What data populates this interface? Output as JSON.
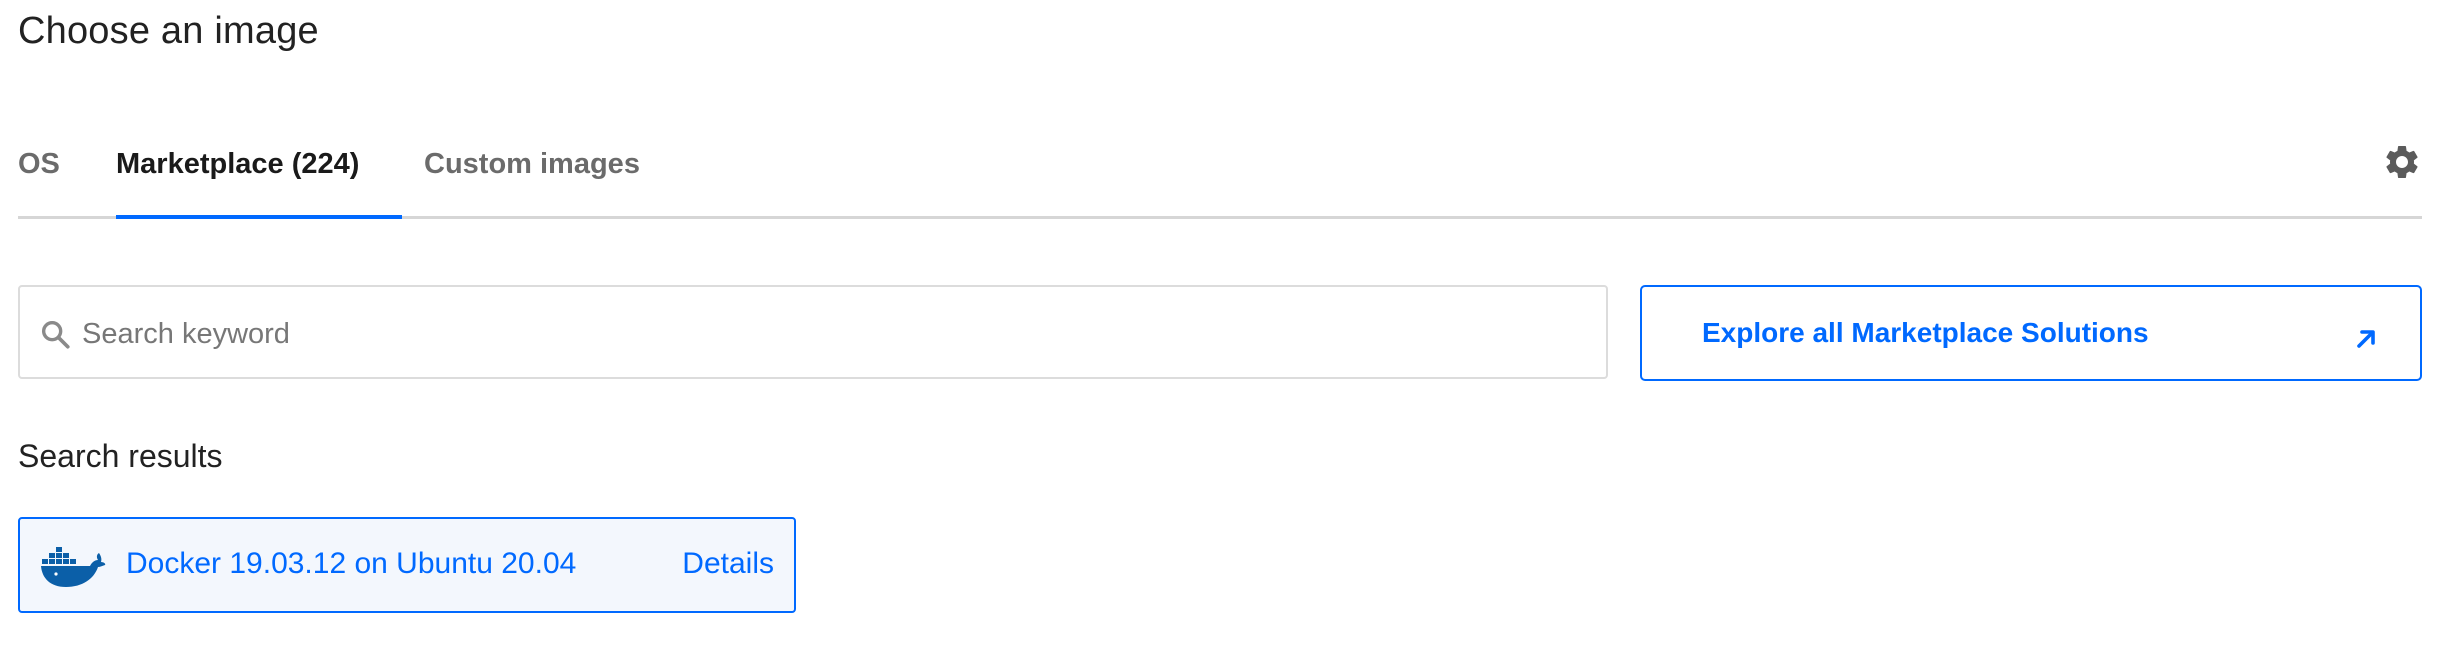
{
  "page": {
    "title": "Choose an image"
  },
  "tabs": [
    {
      "label": "OS",
      "active": false
    },
    {
      "label": "Marketplace (224)",
      "active": true
    },
    {
      "label": "Custom images",
      "active": false
    }
  ],
  "settings": {
    "icon": "gear-icon"
  },
  "search": {
    "placeholder": "Search keyword",
    "value": "",
    "icon": "search-icon"
  },
  "explore": {
    "label": "Explore all Marketplace Solutions",
    "icon": "external-link-arrow-icon"
  },
  "results": {
    "heading": "Search results",
    "items": [
      {
        "label": "Docker 19.03.12 on Ubuntu 20.04",
        "details_label": "Details",
        "icon": "docker-icon"
      }
    ]
  },
  "colors": {
    "accent": "#0069ff",
    "card_bg": "#f3f7fd",
    "tab_inactive": "#6b6b6b",
    "divider": "#d6d6d6"
  }
}
